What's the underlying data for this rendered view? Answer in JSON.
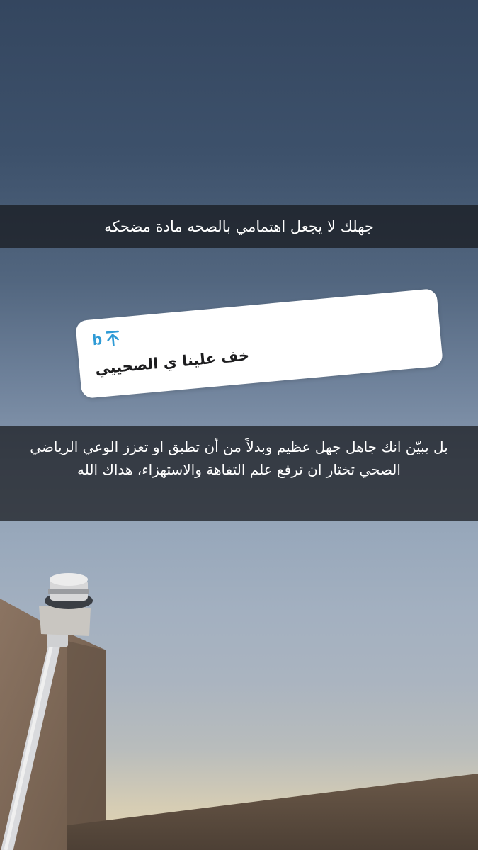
{
  "captions": {
    "top": "جهلك لا يجعل اهتمامي بالصحه مادة مضحكه",
    "bottom": "بل يبيّن انك جاهل جهل عظيم وبدلاً من أن تطبق او تعزز الوعي الرياضي الصحي تختار ان ترفع علم التفاهة والاستهزاء، هداك الله"
  },
  "reply_card": {
    "username": "b",
    "icon": "arrow-up-to-line-icon",
    "message": "خف علينا ي الصحييي"
  },
  "colors": {
    "sky_top": "#34465f",
    "sky_bottom": "#e3d5b0",
    "caption_bar": "#16181c",
    "accent_blue": "#2f9bd6",
    "wall": "#8a7563"
  }
}
